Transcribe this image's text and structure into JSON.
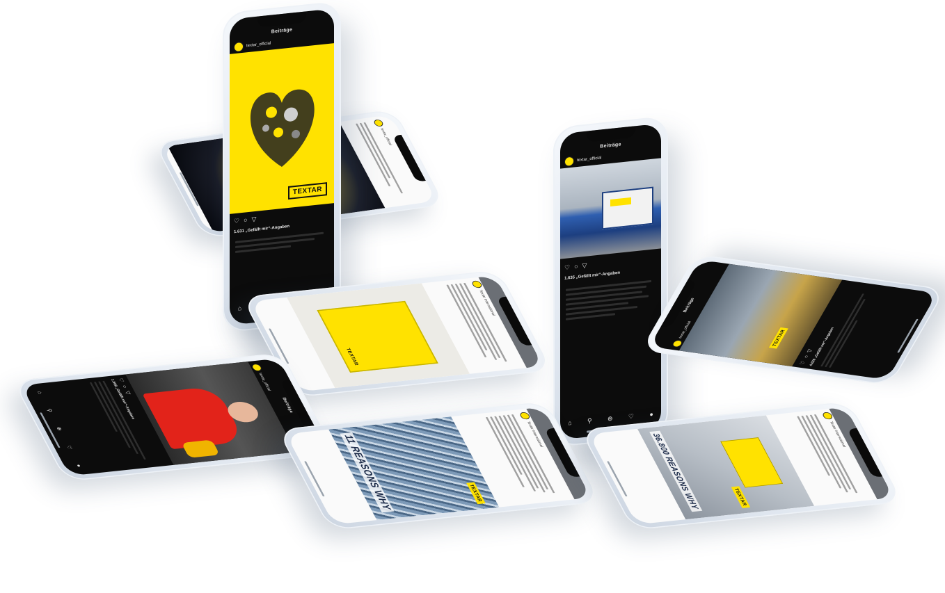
{
  "phones": {
    "p1": {
      "header": "Beiträge",
      "account": "textar_official",
      "likes": "1.631 „Gefällt mir“-Angaben",
      "brand": "TEXTAR",
      "nav": [
        "⌂",
        "⚲",
        "⊕",
        "♡",
        "●"
      ]
    },
    "p2": {
      "account": "textar_official"
    },
    "p3": {
      "header": "Beiträge",
      "account": "textar_official",
      "likes": "1.635 „Gefällt mir“-Angaben",
      "nav": [
        "⌂",
        "⚲",
        "⊕",
        "♡",
        "●"
      ]
    },
    "p4": {
      "account": "Textar International",
      "brand": "TEXTAR"
    },
    "p5": {
      "header": "Beiträge",
      "account": "textar_official",
      "likes": "1.568 „Gefällt mir“-Angaben",
      "nav": [
        "⌂",
        "⚲",
        "⊕",
        "♡",
        "●"
      ]
    },
    "p6": {
      "header": "Beiträge",
      "account": "textar_official",
      "brand": "TEXTAR",
      "likes": "4.020 „Gefällt mir“-Angaben"
    },
    "p7": {
      "account": "Textar International",
      "brand": "TEXTAR",
      "headline": "11 REASONS WHY"
    },
    "p8": {
      "account": "Textar International",
      "brand": "TEXTAR",
      "headline": "36.800 REASONS WHY"
    }
  },
  "colors": {
    "brand_yellow": "#ffe200",
    "ink": "#111111",
    "phone_body": "#e2e8f0"
  }
}
